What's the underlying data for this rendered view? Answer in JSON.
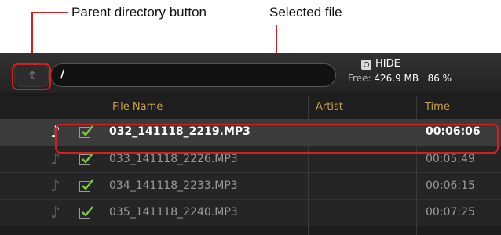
{
  "annotations": {
    "parent_directory": "Parent directory button",
    "selected_file": "Selected file"
  },
  "toolbar": {
    "path": "/",
    "hide_label": "HIDE",
    "free_label": "Free:",
    "free_space": "426.9 MB",
    "free_percent": "86 %"
  },
  "columns": {
    "file_name": "File Name",
    "artist": "Artist",
    "time": "Time"
  },
  "files": [
    {
      "name": "032_141118_2219.MP3",
      "artist": "",
      "time": "00:06:06",
      "selected": true
    },
    {
      "name": "033_141118_2226.MP3",
      "artist": "",
      "time": "00:05:49",
      "selected": false
    },
    {
      "name": "034_141118_2233.MP3",
      "artist": "",
      "time": "00:06:15",
      "selected": false
    },
    {
      "name": "035_141118_2240.MP3",
      "artist": "",
      "time": "00:07:25",
      "selected": false
    }
  ],
  "colors": {
    "annotation": "#d42020",
    "header_text": "#c8a24a",
    "check": "#7ec84a"
  }
}
